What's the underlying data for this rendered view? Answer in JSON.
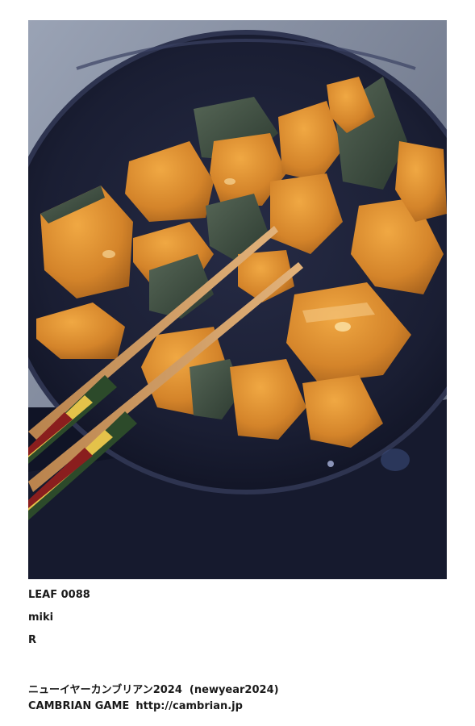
{
  "leaf": {
    "id_label": "LEAF 0088",
    "author": "miki",
    "rating": "R"
  },
  "photo": {
    "subject": "simmered-kabocha-with-chopsticks",
    "colors": {
      "pan": "#1b2036",
      "pumpkin": "#d88a2a",
      "skin": "#3a4a3c",
      "chopstick": "#c9925a",
      "background": "#8a93a6"
    }
  },
  "footer": {
    "event": "ニューイヤーカンブリアン2024  (newyear2024)",
    "game": "CAMBRIAN GAME",
    "url": "http://cambrian.jp"
  }
}
